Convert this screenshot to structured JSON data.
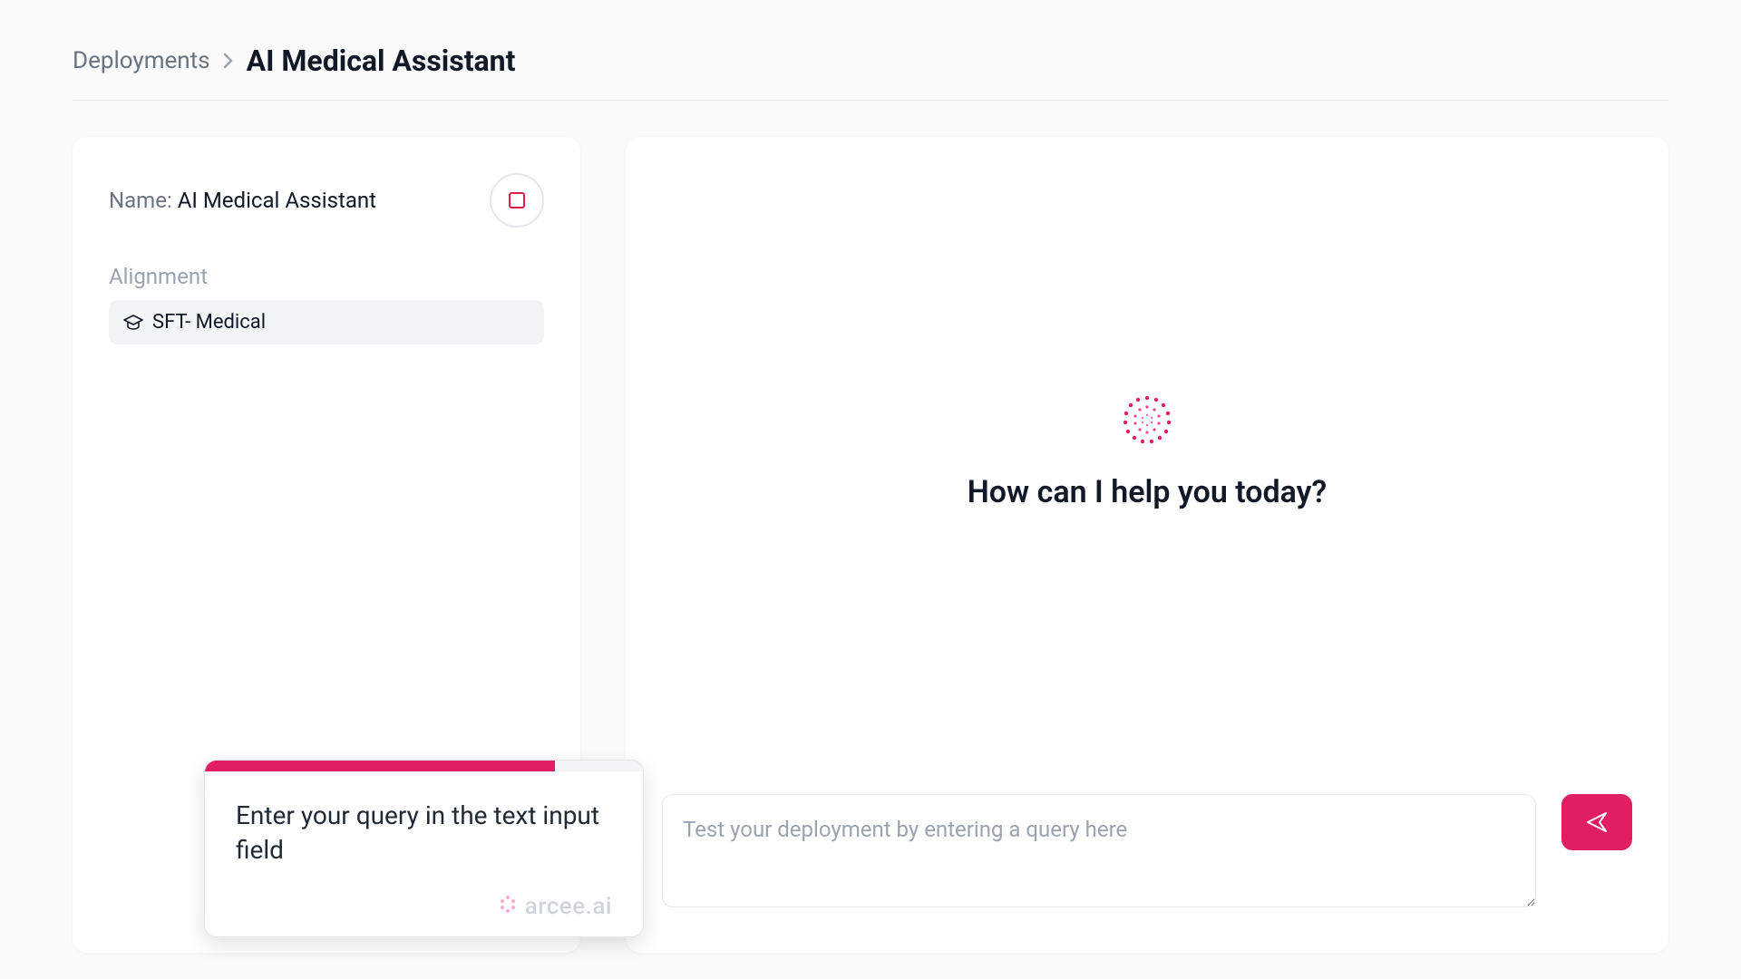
{
  "breadcrumb": {
    "parent": "Deployments",
    "current": "AI Medical Assistant"
  },
  "side_panel": {
    "name_label": "Name: ",
    "name_value": "AI Medical Assistant",
    "alignment_label": "Alignment",
    "alignment_value": "SFT- Medical"
  },
  "chat": {
    "greeting": "How can I help you today?",
    "input_placeholder": "Test your deployment by entering a query here"
  },
  "tooltip": {
    "text": "Enter your query in the text input field",
    "brand": "arcee.ai",
    "progress_percent": 80
  },
  "colors": {
    "accent": "#e11d63",
    "accent_border": "#e11d48"
  }
}
